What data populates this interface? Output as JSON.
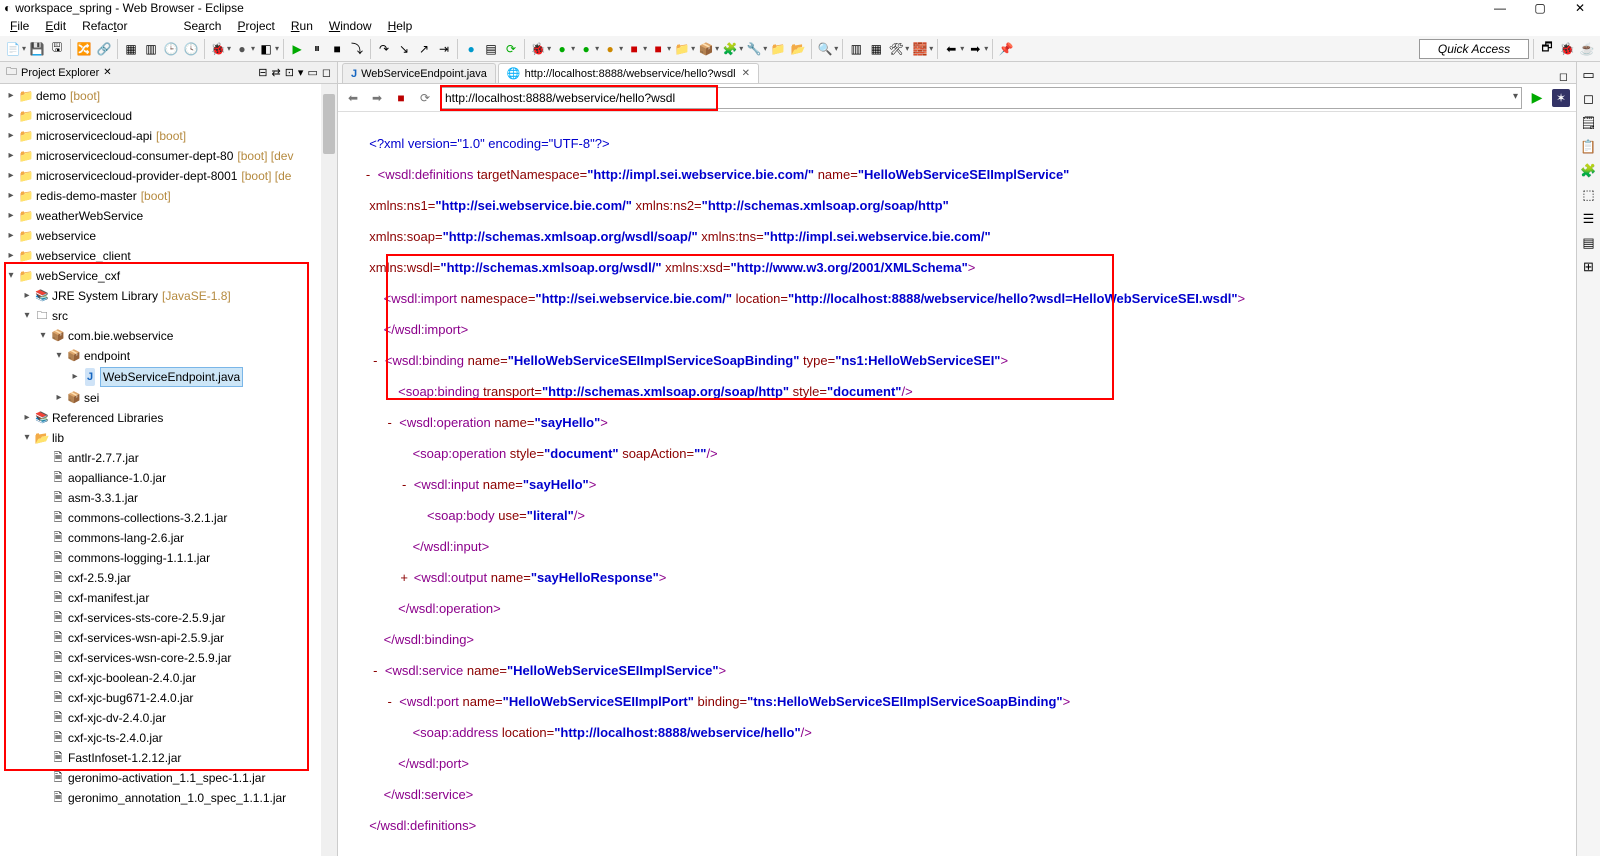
{
  "title": "workspace_spring - Web Browser - Eclipse",
  "menu": [
    "File",
    "Edit",
    "Refactor",
    "Search",
    "Project",
    "Run",
    "Window",
    "Help"
  ],
  "quickAccess": "Quick Access",
  "explorer": {
    "title": "Project Explorer",
    "items": [
      {
        "level": 0,
        "arrow": "▸",
        "icon": "ic-proj",
        "label": "demo",
        "decor": "[boot]"
      },
      {
        "level": 0,
        "arrow": "▸",
        "icon": "ic-proj",
        "label": "microservicecloud",
        "decor": ""
      },
      {
        "level": 0,
        "arrow": "▸",
        "icon": "ic-proj",
        "label": "microservicecloud-api",
        "decor": "[boot]"
      },
      {
        "level": 0,
        "arrow": "▸",
        "icon": "ic-proj",
        "label": "microservicecloud-consumer-dept-80",
        "decor": "[boot] [dev"
      },
      {
        "level": 0,
        "arrow": "▸",
        "icon": "ic-proj",
        "label": "microservicecloud-provider-dept-8001",
        "decor": "[boot] [de"
      },
      {
        "level": 0,
        "arrow": "▸",
        "icon": "ic-proj",
        "label": "redis-demo-master",
        "decor": "[boot]"
      },
      {
        "level": 0,
        "arrow": "▸",
        "icon": "ic-proj",
        "label": "weatherWebService",
        "decor": ""
      },
      {
        "level": 0,
        "arrow": "▸",
        "icon": "ic-proj",
        "label": "webservice",
        "decor": ""
      },
      {
        "level": 0,
        "arrow": "▸",
        "icon": "ic-proj",
        "label": "webservice_client",
        "decor": ""
      },
      {
        "level": 0,
        "arrow": "▾",
        "icon": "ic-proj",
        "label": "webService_cxf",
        "decor": ""
      },
      {
        "level": 1,
        "arrow": "▸",
        "icon": "ic-lib",
        "label": "JRE System Library",
        "decor": "[JavaSE-1.8]"
      },
      {
        "level": 1,
        "arrow": "▾",
        "icon": "ic-src",
        "label": "src",
        "decor": ""
      },
      {
        "level": 2,
        "arrow": "▾",
        "icon": "ic-pkg",
        "label": "com.bie.webservice",
        "decor": ""
      },
      {
        "level": 3,
        "arrow": "▾",
        "icon": "ic-pkg",
        "label": "endpoint",
        "decor": ""
      },
      {
        "level": 4,
        "arrow": "▸",
        "icon": "ic-java",
        "label": "WebServiceEndpoint.java",
        "decor": "",
        "selected": true
      },
      {
        "level": 3,
        "arrow": "▸",
        "icon": "ic-pkg",
        "label": "sei",
        "decor": ""
      },
      {
        "level": 1,
        "arrow": "▸",
        "icon": "ic-lib",
        "label": "Referenced Libraries",
        "decor": ""
      },
      {
        "level": 1,
        "arrow": "▾",
        "icon": "ic-fold",
        "label": "lib",
        "decor": ""
      },
      {
        "level": 2,
        "arrow": "",
        "icon": "ic-jar",
        "label": "antlr-2.7.7.jar",
        "decor": ""
      },
      {
        "level": 2,
        "arrow": "",
        "icon": "ic-jar",
        "label": "aopalliance-1.0.jar",
        "decor": ""
      },
      {
        "level": 2,
        "arrow": "",
        "icon": "ic-jar",
        "label": "asm-3.3.1.jar",
        "decor": ""
      },
      {
        "level": 2,
        "arrow": "",
        "icon": "ic-jar",
        "label": "commons-collections-3.2.1.jar",
        "decor": ""
      },
      {
        "level": 2,
        "arrow": "",
        "icon": "ic-jar",
        "label": "commons-lang-2.6.jar",
        "decor": ""
      },
      {
        "level": 2,
        "arrow": "",
        "icon": "ic-jar",
        "label": "commons-logging-1.1.1.jar",
        "decor": ""
      },
      {
        "level": 2,
        "arrow": "",
        "icon": "ic-jar",
        "label": "cxf-2.5.9.jar",
        "decor": ""
      },
      {
        "level": 2,
        "arrow": "",
        "icon": "ic-jar",
        "label": "cxf-manifest.jar",
        "decor": ""
      },
      {
        "level": 2,
        "arrow": "",
        "icon": "ic-jar",
        "label": "cxf-services-sts-core-2.5.9.jar",
        "decor": ""
      },
      {
        "level": 2,
        "arrow": "",
        "icon": "ic-jar",
        "label": "cxf-services-wsn-api-2.5.9.jar",
        "decor": ""
      },
      {
        "level": 2,
        "arrow": "",
        "icon": "ic-jar",
        "label": "cxf-services-wsn-core-2.5.9.jar",
        "decor": ""
      },
      {
        "level": 2,
        "arrow": "",
        "icon": "ic-jar",
        "label": "cxf-xjc-boolean-2.4.0.jar",
        "decor": ""
      },
      {
        "level": 2,
        "arrow": "",
        "icon": "ic-jar",
        "label": "cxf-xjc-bug671-2.4.0.jar",
        "decor": ""
      },
      {
        "level": 2,
        "arrow": "",
        "icon": "ic-jar",
        "label": "cxf-xjc-dv-2.4.0.jar",
        "decor": ""
      },
      {
        "level": 2,
        "arrow": "",
        "icon": "ic-jar",
        "label": "cxf-xjc-ts-2.4.0.jar",
        "decor": ""
      },
      {
        "level": 2,
        "arrow": "",
        "icon": "ic-jar",
        "label": "FastInfoset-1.2.12.jar",
        "decor": ""
      },
      {
        "level": 2,
        "arrow": "",
        "icon": "ic-jar",
        "label": "geronimo-activation_1.1_spec-1.1.jar",
        "decor": ""
      },
      {
        "level": 2,
        "arrow": "",
        "icon": "ic-jar",
        "label": "geronimo_annotation_1.0_spec_1.1.1.jar",
        "decor": ""
      }
    ]
  },
  "tabs": [
    {
      "icon": "J",
      "label": "WebServiceEndpoint.java",
      "active": false
    },
    {
      "icon": "🌐",
      "label": "http://localhost:8888/webservice/hello?wsdl",
      "active": true
    }
  ],
  "url": "http://localhost:8888/webservice/hello?wsdl",
  "xml": {
    "l1": "<?xml version=\"1.0\" encoding=\"UTF-8\"?>",
    "defs_open": "<wsdl:definitions",
    "tns_attr": " targetNamespace=",
    "tns_val": "\"http://impl.sei.webservice.bie.com/\"",
    "name_attr": " name=",
    "name_val": "\"HelloWebServiceSEIImplService\"",
    "ns1_attr": "xmlns:ns1=",
    "ns1_val": "\"http://sei.webservice.bie.com/\"",
    "ns2_attr": " xmlns:ns2=",
    "ns2_val": "\"http://schemas.xmlsoap.org/soap/http\"",
    "soap_attr": "xmlns:soap=",
    "soap_val": "\"http://schemas.xmlsoap.org/wsdl/soap/\"",
    "tns2_attr": " xmlns:tns=",
    "tns2_val": "\"http://impl.sei.webservice.bie.com/\"",
    "wsdl_attr": "xmlns:wsdl=",
    "wsdl_val": "\"http://schemas.xmlsoap.org/wsdl/\"",
    "xsd_attr": " xmlns:xsd=",
    "xsd_val": "\"http://www.w3.org/2001/XMLSchema\"",
    "import_tag": "<wsdl:import",
    "import_ns": " namespace=",
    "import_ns_val": "\"http://sei.webservice.bie.com/\"",
    "import_loc": " location=",
    "import_loc_val": "\"http://localhost:8888/webservice/hello?wsdl=HelloWebServiceSEI.wsdl\"",
    "import_close": "</wsdl:import>",
    "binding_open": "<wsdl:binding",
    "binding_name": " name=",
    "binding_name_val": "\"HelloWebServiceSEIImplServiceSoapBinding\"",
    "binding_type": " type=",
    "binding_type_val": "\"ns1:HelloWebServiceSEI\"",
    "sbind_open": "<soap:binding",
    "sbind_trans": " transport=",
    "sbind_trans_val": "\"http://schemas.xmlsoap.org/soap/http\"",
    "sbind_style": " style=",
    "sbind_style_val": "\"document\"",
    "op_open": "<wsdl:operation",
    "op_name": " name=",
    "op_name_val": "\"sayHello\"",
    "sop_open": "<soap:operation",
    "sop_style": " style=",
    "sop_style_val": "\"document\"",
    "sop_action": " soapAction=",
    "sop_action_val": "\"\"",
    "in_open": "<wsdl:input",
    "in_name": " name=",
    "in_name_val": "\"sayHello\"",
    "sbody_open": "<soap:body",
    "sbody_use": " use=",
    "sbody_use_val": "\"literal\"",
    "in_close": "</wsdl:input>",
    "out_open": "<wsdl:output",
    "out_name": " name=",
    "out_name_val": "\"sayHelloResponse\"",
    "op_close": "</wsdl:operation>",
    "binding_close": "</wsdl:binding>",
    "svc_open": "<wsdl:service",
    "svc_name": " name=",
    "svc_name_val": "\"HelloWebServiceSEIImplService\"",
    "port_open": "<wsdl:port",
    "port_name": " name=",
    "port_name_val": "\"HelloWebServiceSEIImplPort\"",
    "port_bind": " binding=",
    "port_bind_val": "\"tns:HelloWebServiceSEIImplServiceSoapBinding\"",
    "addr_open": "<soap:address",
    "addr_loc": " location=",
    "addr_loc_val": "\"http://localhost:8888/webservice/hello\"",
    "port_close": "</wsdl:port>",
    "svc_close": "</wsdl:service>",
    "defs_close": "</wsdl:definitions>"
  }
}
